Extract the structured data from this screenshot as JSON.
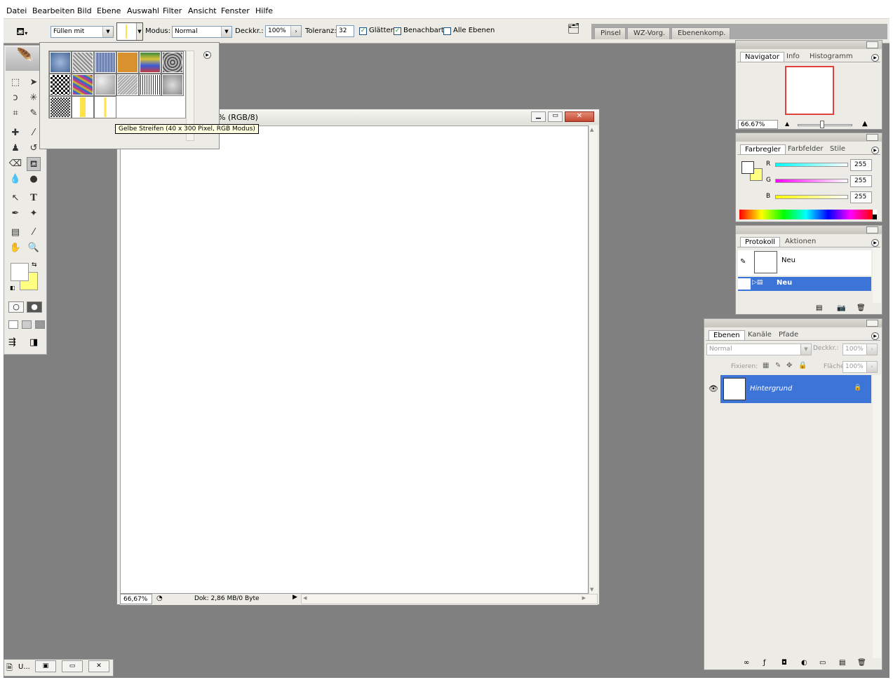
{
  "menu": [
    "Datei",
    "Bearbeiten",
    "Bild",
    "Ebene",
    "Auswahl",
    "Filter",
    "Ansicht",
    "Fenster",
    "Hilfe"
  ],
  "options": {
    "fill_label": "Füllen mit",
    "mode_label": "Modus:",
    "mode_value": "Normal",
    "opacity_label": "Deckkr.:",
    "opacity_value": "100%",
    "tolerance_label": "Toleranz:",
    "tolerance_value": "32",
    "antialias_label": "Glätten",
    "contiguous_label": "Benachbart",
    "all_layers_label": "Alle Ebenen"
  },
  "palette_well": {
    "tabs": [
      "Pinsel",
      "WZ-Vorg.",
      "Ebenenkomp."
    ]
  },
  "pattern_picker": {
    "tooltip": "Gelbe Streifen (40 x 300 Pixel, RGB Modus)"
  },
  "document": {
    "title_fragment": "% (RGB/8)",
    "zoom": "66,67%",
    "status": "Dok: 2,86 MB/0 Byte"
  },
  "navigator": {
    "tabs": [
      "Navigator",
      "Info",
      "Histogramm"
    ],
    "zoom": "66.67%"
  },
  "color": {
    "tabs": [
      "Farbregler",
      "Farbfelder",
      "Stile"
    ],
    "r_label": "R",
    "g_label": "G",
    "b_label": "B",
    "r": "255",
    "g": "255",
    "b": "255",
    "foreground": "#ffffff",
    "background": "#ffff80"
  },
  "history": {
    "tabs": [
      "Protokoll",
      "Aktionen"
    ],
    "snapshot_label": "Neu",
    "state_label": "Neu"
  },
  "layers": {
    "tabs": [
      "Ebenen",
      "Kanäle",
      "Pfade"
    ],
    "blend": "Normal",
    "opacity_label": "Deckkr.:",
    "opacity": "100%",
    "lock_label": "Fixieren:",
    "fill_label": "Fläche:",
    "fill": "100%",
    "layer_name": "Hintergrund"
  },
  "taskbar": {
    "label": "U..."
  }
}
